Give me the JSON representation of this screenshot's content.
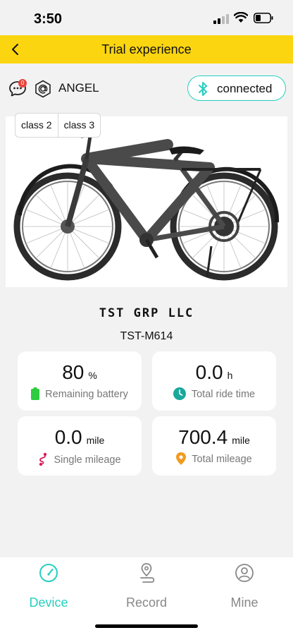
{
  "status_bar": {
    "time": "3:50"
  },
  "nav": {
    "title": "Trial experience"
  },
  "device": {
    "message_badge": "0",
    "user_name": "ANGEL",
    "bluetooth_status": "connected"
  },
  "bike": {
    "classes": [
      "class 2",
      "class 3"
    ],
    "brand": "TST GRP LLC",
    "model": "TST-M614"
  },
  "stats": {
    "battery": {
      "value": "80",
      "unit": "%",
      "label": "Remaining battery"
    },
    "ride_time": {
      "value": "0.0",
      "unit": "h",
      "label": "Total ride time"
    },
    "single_mileage": {
      "value": "0.0",
      "unit": "mile",
      "label": "Single mileage"
    },
    "total_mileage": {
      "value": "700.4",
      "unit": "mile",
      "label": "Total mileage"
    }
  },
  "tabs": [
    {
      "label": "Device",
      "icon": "speedometer-icon",
      "active": true
    },
    {
      "label": "Record",
      "icon": "route-pin-icon",
      "active": false
    },
    {
      "label": "Mine",
      "icon": "person-icon",
      "active": false
    }
  ],
  "colors": {
    "nav_bg": "#fcd511",
    "accent": "#27cfc0",
    "battery": "#2ecc40",
    "clock": "#1aa89b",
    "route": "#d61e5a",
    "pin": "#f39a1f"
  }
}
